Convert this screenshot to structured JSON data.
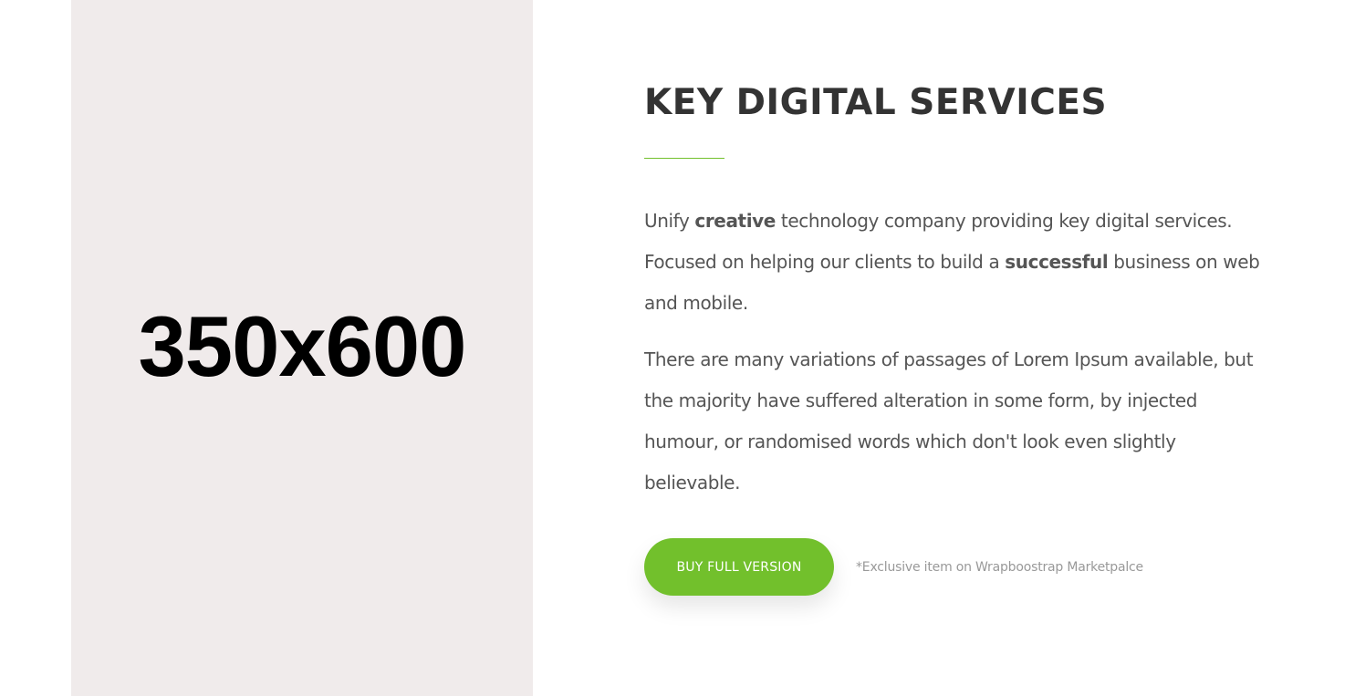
{
  "placeholder": {
    "label": "350x600"
  },
  "section": {
    "title": "KEY DIGITAL SERVICES",
    "accent_color": "#72c02c",
    "paragraph1": {
      "p1": "Unify ",
      "b1": "creative",
      "p2": " technology company providing key digital services. Focused on helping our clients to build a ",
      "b2": "successful",
      "p3": " business on web and mobile."
    },
    "paragraph2": "There are many variations of passages of Lorem Ipsum available, but the majority have suffered alteration in some form, by injected humour, or randomised words which don't look even slightly believable.",
    "cta": {
      "button_label": "BUY FULL VERSION",
      "note": "*Exclusive item on Wrapboostrap Marketpalce"
    }
  }
}
